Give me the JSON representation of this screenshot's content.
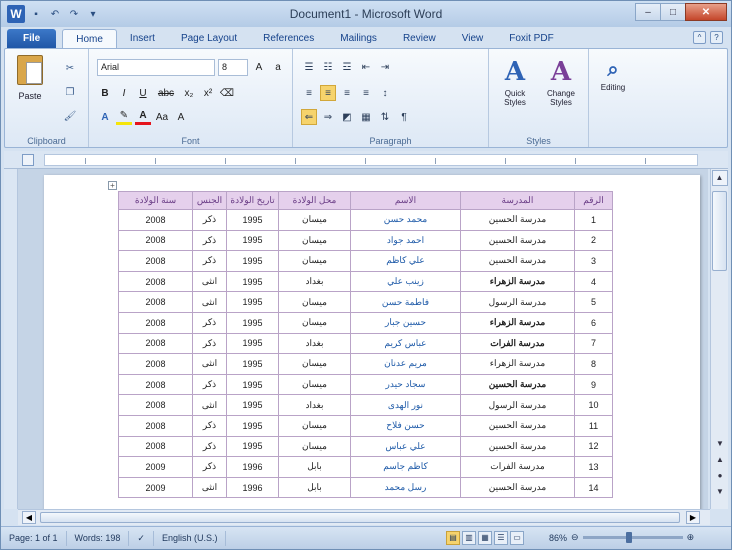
{
  "window": {
    "title": "Document1 - Microsoft Word",
    "logo": "W",
    "controls": {
      "minimize": "–",
      "maximize": "□",
      "close": "✕"
    }
  },
  "quick_access": [
    {
      "icon": "save-icon",
      "glyph": "▪"
    },
    {
      "icon": "undo-icon",
      "glyph": "↶"
    },
    {
      "icon": "redo-icon",
      "glyph": "↷"
    },
    {
      "icon": "customize-icon",
      "glyph": "▾"
    }
  ],
  "tabs": {
    "file": "File",
    "items": [
      "Home",
      "Insert",
      "Page Layout",
      "References",
      "Mailings",
      "Review",
      "View",
      "Foxit PDF"
    ],
    "active": "Home"
  },
  "ribbon": {
    "clipboard": {
      "paste_label": "Paste",
      "group_label": "Clipboard"
    },
    "font": {
      "font_name": "Arial",
      "font_size": "8",
      "buttons": [
        "B",
        "I",
        "U",
        "abc",
        "x₂",
        "x²"
      ],
      "group_label": "Font"
    },
    "paragraph": {
      "group_label": "Paragraph"
    },
    "styles": {
      "quick_styles": "Quick Styles",
      "change_styles": "Change Styles",
      "group_label": "Styles"
    },
    "editing": {
      "label": "Editing"
    },
    "colors": {
      "font_color": "#e5141c",
      "highlight": "#f5e50a",
      "accent": "#2e63b5"
    }
  },
  "table": {
    "headers": [
      "الرقم",
      "المدرسة",
      "الاسم",
      "محل الولادة",
      "تاريخ الولادة",
      "الجنس",
      "سنة الولادة"
    ],
    "rows": [
      [
        "1",
        "مدرسة الحسين",
        "محمد حسن",
        "ميسان",
        "1995",
        "ذكر",
        "2008"
      ],
      [
        "2",
        "مدرسة الحسين",
        "احمد جواد",
        "ميسان",
        "1995",
        "ذكر",
        "2008"
      ],
      [
        "3",
        "مدرسة الحسين",
        "علي كاظم",
        "ميسان",
        "1995",
        "ذكر",
        "2008"
      ],
      [
        "4",
        "مدرسة الزهراء",
        "زينب علي",
        "بغداد",
        "1995",
        "انثى",
        "2008"
      ],
      [
        "5",
        "مدرسة الرسول",
        "فاطمة حسن",
        "ميسان",
        "1995",
        "انثى",
        "2008"
      ],
      [
        "6",
        "مدرسة الزهراء",
        "حسين جبار",
        "ميسان",
        "1995",
        "ذكر",
        "2008"
      ],
      [
        "7",
        "مدرسة الفرات",
        "عباس كريم",
        "بغداد",
        "1995",
        "ذكر",
        "2008"
      ],
      [
        "8",
        "مدرسة الزهراء",
        "مريم عدنان",
        "ميسان",
        "1995",
        "انثى",
        "2008"
      ],
      [
        "9",
        "مدرسة الحسين",
        "سجاد حيدر",
        "ميسان",
        "1995",
        "ذكر",
        "2008"
      ],
      [
        "10",
        "مدرسة الرسول",
        "نور الهدى",
        "بغداد",
        "1995",
        "انثى",
        "2008"
      ],
      [
        "11",
        "مدرسة الحسين",
        "حسن فلاح",
        "ميسان",
        "1995",
        "ذكر",
        "2008"
      ],
      [
        "12",
        "مدرسة الحسين",
        "علي عباس",
        "ميسان",
        "1995",
        "ذكر",
        "2008"
      ],
      [
        "13",
        "مدرسة الفرات",
        "كاظم جاسم",
        "بابل",
        "1996",
        "ذكر",
        "2009"
      ],
      [
        "14",
        "مدرسة الحسين",
        "رسل محمد",
        "بابل",
        "1996",
        "انثى",
        "2009"
      ]
    ]
  },
  "statusbar": {
    "page": "Page: 1 of 1",
    "words": "Words: 198",
    "language": "English (U.S.)",
    "zoom": "86%",
    "zoom_fraction": 0.46
  }
}
